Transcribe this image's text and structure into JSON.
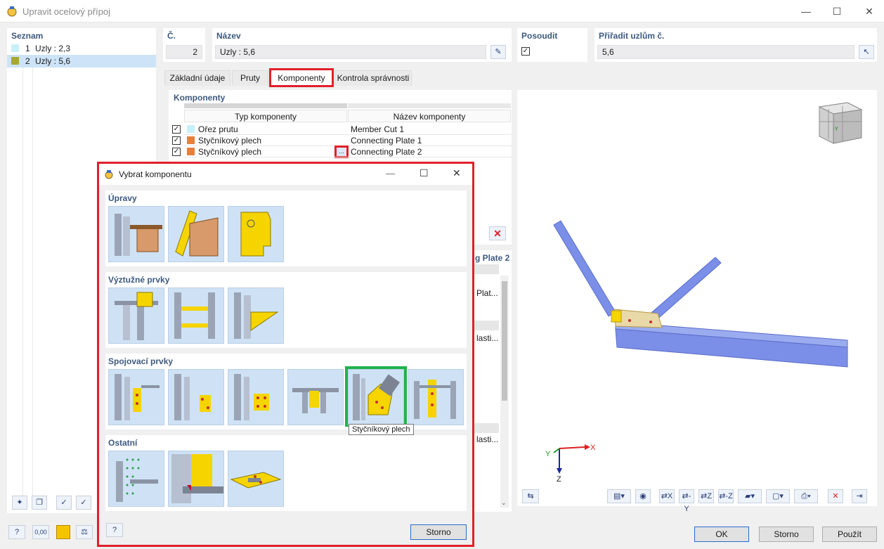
{
  "window": {
    "title": "Upravit ocelový přípoj",
    "controls": {
      "minimize": "—",
      "maximize": "☐",
      "close": "✕"
    }
  },
  "list": {
    "header": "Seznam",
    "items": [
      {
        "no": "1",
        "label": "Uzly : 2,3",
        "color": "#c8f0f8"
      },
      {
        "no": "2",
        "label": "Uzly : 5,6",
        "color": "#a8a830"
      }
    ]
  },
  "header_fields": {
    "no_label": "Č.",
    "no_value": "2",
    "name_label": "Název",
    "name_value": "Uzly : 5,6",
    "check_label": "Posoudit",
    "check_value": "✓",
    "assign_label": "Přiřadit uzlům č.",
    "assign_value": "5,6"
  },
  "tabs": [
    "Základní údaje",
    "Pruty",
    "Komponenty",
    "Kontrola správnosti"
  ],
  "components": {
    "header": "Komponenty",
    "col_type": "Typ komponenty",
    "col_name": "Název komponenty",
    "rows": [
      {
        "type": "Ořez prutu",
        "name": "Member Cut 1",
        "color": "#c8f0f8"
      },
      {
        "type": "Styčníkový plech",
        "name": "Connecting Plate 1",
        "color": "#e8803a"
      },
      {
        "type": "Styčníkový plech",
        "name": "Connecting Plate 2",
        "color": "#e8803a"
      }
    ],
    "more_button": "...",
    "delete_icon": "✕"
  },
  "behind_panel": {
    "title": "g Plate 2",
    "cells": [
      "Plat...",
      "lasti...",
      "lasti..."
    ]
  },
  "view": {
    "axis_x": "X",
    "axis_y": "Y",
    "axis_z": "Z",
    "cube_label": "-Y"
  },
  "view_toolbar": [
    "⇄X",
    "⇄-Y",
    "⇄Z",
    "⇄-Z"
  ],
  "bottom_left": {
    "value_icon": "0,00"
  },
  "footer": {
    "ok": "OK",
    "cancel": "Storno",
    "apply": "Použít"
  },
  "dialog": {
    "title": "Vybrat komponentu",
    "controls": {
      "minimize": "—",
      "maximize": "☐",
      "close": "✕"
    },
    "sections": [
      {
        "title": "Úpravy",
        "count": 3
      },
      {
        "title": "Výztužné prvky",
        "count": 3
      },
      {
        "title": "Spojovací prvky",
        "count": 6
      },
      {
        "title": "Ostatní",
        "count": 3
      }
    ],
    "tooltip": "Styčníkový plech",
    "cancel": "Storno"
  },
  "colors": {
    "highlight_red": "#e0202a",
    "highlight_green": "#22b24c",
    "member_blue": "#7b8fe8",
    "plate_yellow": "#f5d400"
  }
}
